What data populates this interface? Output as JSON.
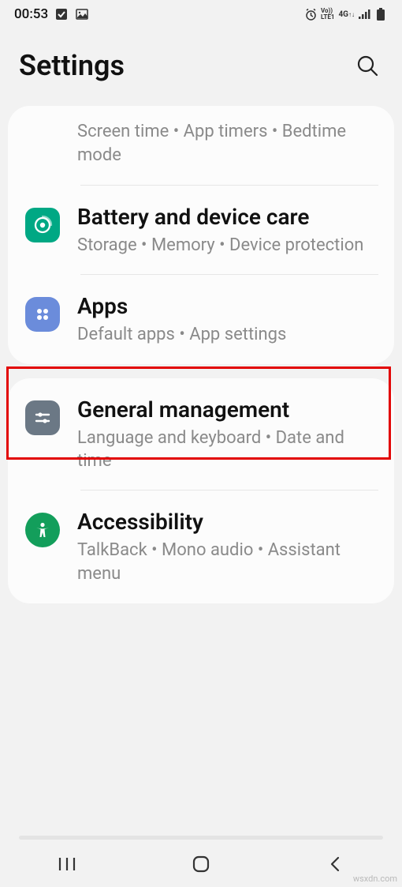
{
  "status": {
    "time": "00:53",
    "icons_left": [
      "checkbox-icon",
      "image-icon"
    ],
    "icons_right": [
      "alarm-icon",
      "volte-icon",
      "4g-icon",
      "signal-icon",
      "battery-icon"
    ]
  },
  "header": {
    "title": "Settings"
  },
  "card1": {
    "item0": {
      "subtitle": "Screen time  •  App timers  •  Bedtime mode"
    },
    "item1": {
      "title": "Battery and device care",
      "subtitle": "Storage  •  Memory  •  Device protection"
    },
    "item2": {
      "title": "Apps",
      "subtitle": "Default apps  •  App settings"
    }
  },
  "card2": {
    "item0": {
      "title": "General management",
      "subtitle": "Language and keyboard  •  Date and time"
    },
    "item1": {
      "title": "Accessibility",
      "subtitle": "TalkBack  •  Mono audio  •  Assistant menu"
    }
  },
  "watermark": "wsxdn.com"
}
